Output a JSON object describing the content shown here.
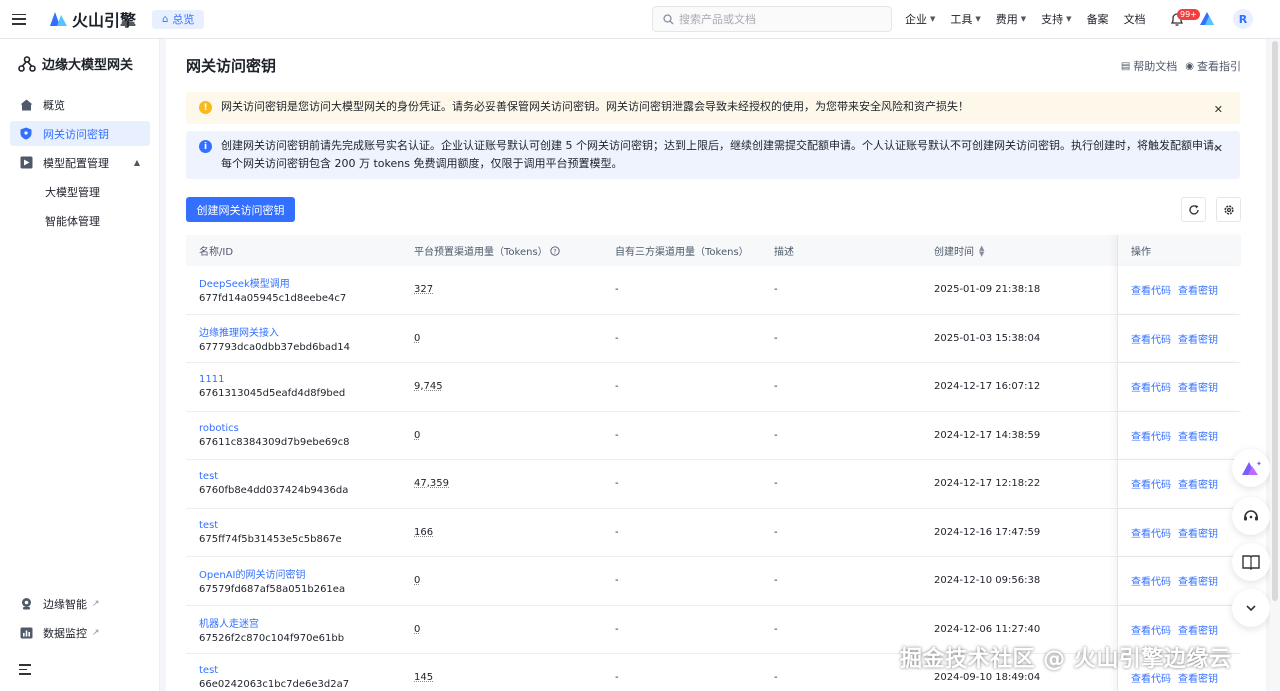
{
  "topbar": {
    "logo_text": "火山引擎",
    "overview": "总览",
    "search_placeholder": "搜索产品或文档",
    "nav": [
      "企业",
      "工具",
      "费用",
      "支持",
      "备案",
      "文档"
    ],
    "nav_has_caret": [
      true,
      true,
      true,
      true,
      false,
      false
    ],
    "badge": "99+",
    "avatar": "R"
  },
  "sidebar": {
    "title": "边缘大模型网关",
    "items": [
      {
        "label": "概览",
        "icon": "home-icon"
      },
      {
        "label": "网关访问密钥",
        "icon": "key-shield-icon",
        "active": true
      },
      {
        "label": "模型配置管理",
        "icon": "model-config-icon"
      },
      {
        "label": "大模型管理"
      },
      {
        "label": "智能体管理"
      },
      {
        "label": "边缘智能",
        "icon": "edge-ai-icon"
      },
      {
        "label": "数据监控",
        "icon": "monitor-icon"
      }
    ]
  },
  "main": {
    "title": "网关访问密钥",
    "help_doc": "帮助文档",
    "view_guide": "查看指引",
    "alert_warn": "网关访问密钥是您访问大模型网关的身份凭证。请务必妥善保管网关访问密钥。网关访问密钥泄露会导致未经授权的使用，为您带来安全风险和资产损失！",
    "alert_info_1": "创建网关访问密钥前请先完成账号实名认证。企业认证账号默认可创建 5 个网关访问密钥；达到上限后，继续创建需提交配额申请。个人认证账号默认不可创建网关访问密钥。执行创建时，将触发配额申请。",
    "alert_info_2": "每个网关访问密钥包含 200 万 tokens 免费调用额度，仅限于调用平台预置模型。",
    "create_button": "创建网关访问密钥"
  },
  "table": {
    "headers": {
      "name": "名称/ID",
      "platform_usage": "平台预置渠道用量（Tokens）",
      "third_party_usage": "自有三方渠道用量（Tokens）",
      "description": "描述",
      "created": "创建时间",
      "actions": "操作"
    },
    "view_code": "查看代码",
    "view_key": "查看密钥",
    "rows": [
      {
        "name": "DeepSeek模型调用",
        "id": "677fd14a05945c1d8eebe4c7",
        "usage": "327",
        "third": "-",
        "desc": "-",
        "created": "2025-01-09 21:38:18"
      },
      {
        "name": "边缘推理网关接入",
        "id": "677793dca0dbb37ebd6bad14",
        "usage": "0",
        "third": "-",
        "desc": "-",
        "created": "2025-01-03 15:38:04"
      },
      {
        "name": "1111",
        "id": "6761313045d5eafd4d8f9bed",
        "usage": "9,745",
        "third": "-",
        "desc": "-",
        "created": "2024-12-17 16:07:12"
      },
      {
        "name": "robotics",
        "id": "67611c8384309d7b9ebe69c8",
        "usage": "0",
        "third": "-",
        "desc": "-",
        "created": "2024-12-17 14:38:59"
      },
      {
        "name": "test",
        "id": "6760fb8e4dd037424b9436da",
        "usage": "47,359",
        "third": "-",
        "desc": "-",
        "created": "2024-12-17 12:18:22"
      },
      {
        "name": "test",
        "id": "675ff74f5b31453e5c5b867e",
        "usage": "166",
        "third": "-",
        "desc": "-",
        "created": "2024-12-16 17:47:59"
      },
      {
        "name": "OpenAI的网关访问密钥",
        "id": "67579fd687af58a051b261ea",
        "usage": "0",
        "third": "-",
        "desc": "-",
        "created": "2024-12-10 09:56:38"
      },
      {
        "name": "机器人走迷宫",
        "id": "67526f2c870c104f970e61bb",
        "usage": "0",
        "third": "-",
        "desc": "-",
        "created": "2024-12-06 11:27:40"
      },
      {
        "name": "test",
        "id": "66e0242063c1bc7de6e3d2a7",
        "usage": "145",
        "third": "-",
        "desc": "-",
        "created": "2024-09-10 18:49:04"
      }
    ]
  },
  "watermark": "掘金技术社区 @ 火山引擎边缘云",
  "colors": {
    "accent": "#3370ff",
    "warn": "#f7ba1e",
    "badge": "#f53f3f"
  }
}
